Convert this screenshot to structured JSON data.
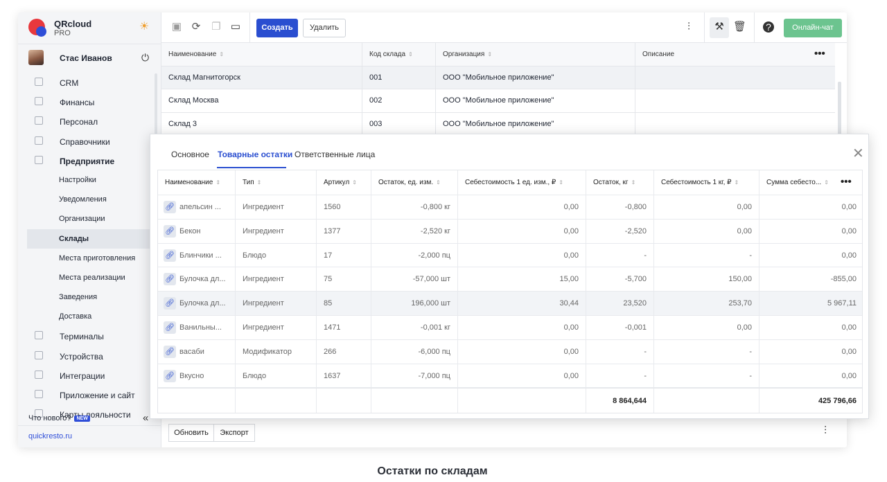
{
  "brand": {
    "name": "QRcloud",
    "plan": "PRO"
  },
  "user": {
    "name": "Стас Иванов"
  },
  "nav": [
    {
      "label": "CRM",
      "kind": "top"
    },
    {
      "label": "Финансы",
      "kind": "top"
    },
    {
      "label": "Персонал",
      "kind": "top"
    },
    {
      "label": "Справочники",
      "kind": "top"
    },
    {
      "label": "Предприятие",
      "kind": "top-bold"
    },
    {
      "label": "Настройки",
      "kind": "sub"
    },
    {
      "label": "Уведомления",
      "kind": "sub"
    },
    {
      "label": "Организации",
      "kind": "sub"
    },
    {
      "label": "Склады",
      "kind": "active"
    },
    {
      "label": "Места приготовления",
      "kind": "sub"
    },
    {
      "label": "Места реализации",
      "kind": "sub"
    },
    {
      "label": "Заведения",
      "kind": "sub"
    },
    {
      "label": "Доставка",
      "kind": "sub"
    },
    {
      "label": "Терминалы",
      "kind": "top"
    },
    {
      "label": "Устройства",
      "kind": "top"
    },
    {
      "label": "Интеграции",
      "kind": "top"
    },
    {
      "label": "Приложение и сайт",
      "kind": "top"
    },
    {
      "label": "Карты лояльности",
      "kind": "top"
    }
  ],
  "sidebar_footer": {
    "whatsnew": "Что нового?",
    "badge": "NEW",
    "site": "quickresto.ru"
  },
  "toolbar": {
    "create": "Создать",
    "delete": "Удалить",
    "chat": "Онлайн-чат"
  },
  "warehouses": {
    "columns": [
      "Наименование",
      "Код склада",
      "Организация",
      "Описание"
    ],
    "rows": [
      [
        "Склад Магнитогорск",
        "001",
        "ООО \"Мобильное приложение\"",
        ""
      ],
      [
        "Склад Москва",
        "002",
        "ООО \"Мобильное приложение\"",
        ""
      ],
      [
        "Склад 3",
        "003",
        "ООО \"Мобильное приложение\"",
        ""
      ]
    ]
  },
  "modal": {
    "tabs": [
      "Основное",
      "Товарные остатки",
      "Ответственные лица"
    ],
    "active_tab": 1,
    "columns": [
      "Наименование",
      "Тип",
      "Артикул",
      "Остаток, ед. изм.",
      "Себестоимость 1 ед. изм., ₽",
      "Остаток, кг",
      "Себестоимость 1 кг, ₽",
      "Сумма себесто..."
    ],
    "rows": [
      [
        "апельсин ...",
        "Ингредиент",
        "1560",
        "-0,800 кг",
        "0,00",
        "-0,800",
        "0,00",
        "0,00"
      ],
      [
        "Бекон",
        "Ингредиент",
        "1377",
        "-2,520 кг",
        "0,00",
        "-2,520",
        "0,00",
        "0,00"
      ],
      [
        "Блинчики ...",
        "Блюдо",
        "17",
        "-2,000 пц",
        "0,00",
        "-",
        "-",
        "0,00"
      ],
      [
        "Булочка дл...",
        "Ингредиент",
        "75",
        "-57,000 шт",
        "15,00",
        "-5,700",
        "150,00",
        "-855,00"
      ],
      [
        "Булочка дл...",
        "Ингредиент",
        "85",
        "196,000 шт",
        "30,44",
        "23,520",
        "253,70",
        "5 967,11"
      ],
      [
        "Ванильны...",
        "Ингредиент",
        "1471",
        "-0,001 кг",
        "0,00",
        "-0,001",
        "0,00",
        "0,00"
      ],
      [
        "васаби",
        "Модификатор",
        "266",
        "-6,000 пц",
        "0,00",
        "-",
        "-",
        "0,00"
      ],
      [
        "Вкусно",
        "Блюдо",
        "1637",
        "-7,000 пц",
        "0,00",
        "-",
        "-",
        "0,00"
      ]
    ],
    "totals": {
      "weight": "8 864,644",
      "sum": "425 796,66"
    }
  },
  "bottom": {
    "refresh": "Обновить",
    "export": "Экспорт"
  },
  "caption": "Остатки по складам"
}
